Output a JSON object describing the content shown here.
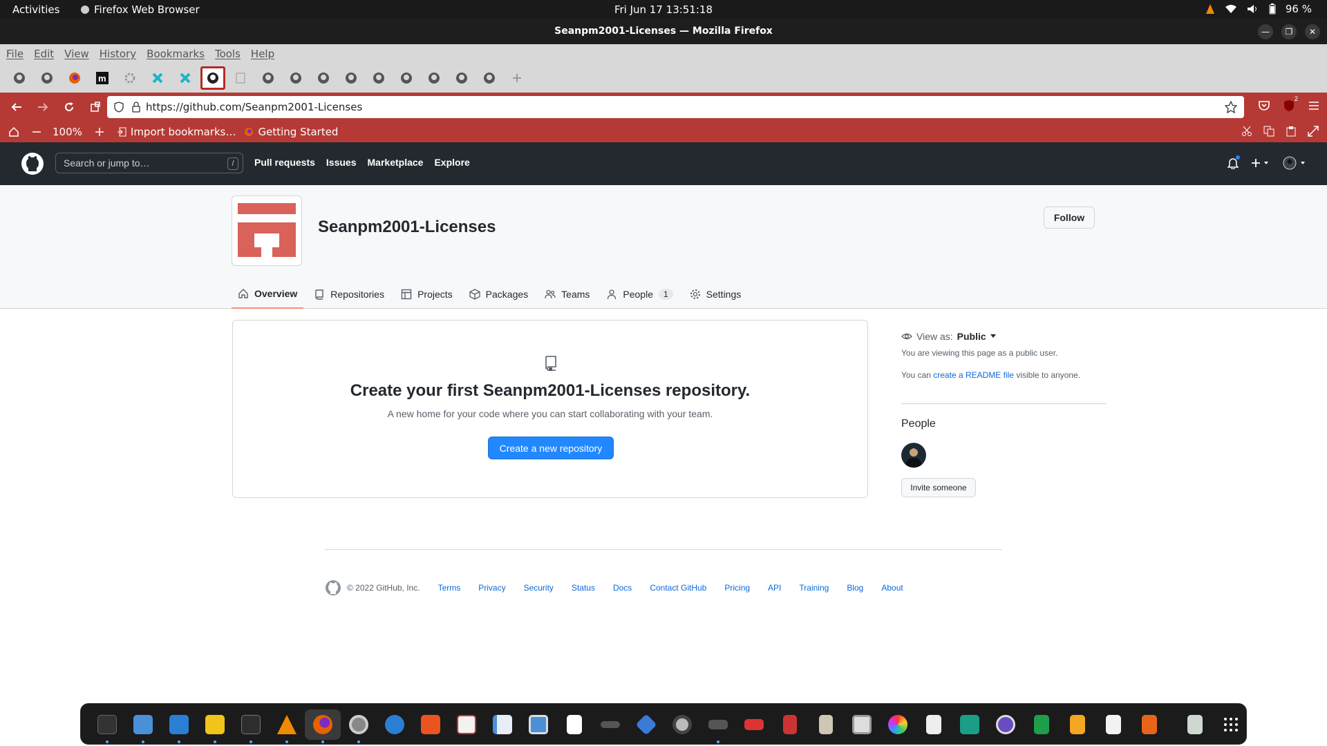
{
  "system": {
    "activities": "Activities",
    "app_name": "Firefox Web Browser",
    "clock": "Fri Jun 17  13:51:18",
    "battery": "96 %"
  },
  "window": {
    "title": "Seanpm2001-Licenses — Mozilla Firefox"
  },
  "menubar": {
    "items": [
      "File",
      "Edit",
      "View",
      "History",
      "Bookmarks",
      "Tools",
      "Help"
    ]
  },
  "navbar": {
    "url": "https://github.com/Seanpm2001-Licenses",
    "ext_badge": "2"
  },
  "bookmarks_bar": {
    "zoom": "100%",
    "items": [
      "Import bookmarks…",
      "Getting Started"
    ]
  },
  "github_header": {
    "search_placeholder": "Search or jump to…",
    "search_shortcut": "/",
    "nav": [
      "Pull requests",
      "Issues",
      "Marketplace",
      "Explore"
    ]
  },
  "org": {
    "name": "Seanpm2001-Licenses",
    "follow_label": "Follow",
    "avatar_color": "#d9625a",
    "tabs": [
      {
        "label": "Overview",
        "icon": "home-icon",
        "selected": true
      },
      {
        "label": "Repositories",
        "icon": "repo-icon"
      },
      {
        "label": "Projects",
        "icon": "table-icon"
      },
      {
        "label": "Packages",
        "icon": "package-icon"
      },
      {
        "label": "Teams",
        "icon": "people-icon"
      },
      {
        "label": "People",
        "icon": "person-icon",
        "count": "1"
      },
      {
        "label": "Settings",
        "icon": "gear-icon"
      }
    ]
  },
  "blankslate": {
    "title": "Create your first Seanpm2001-Licenses repository.",
    "description": "A new home for your code where you can start collaborating with your team.",
    "button": "Create a new repository"
  },
  "sidebar": {
    "view_as_label": "View as:",
    "view_as_value": "Public",
    "viewing_text": "You are viewing this page as a public user.",
    "readme_prefix": "You can ",
    "readme_link": "create a README file",
    "readme_suffix": " visible to anyone.",
    "people_heading": "People",
    "invite_button": "Invite someone"
  },
  "footer": {
    "copyright": "© 2022 GitHub, Inc.",
    "links": [
      "Terms",
      "Privacy",
      "Security",
      "Status",
      "Docs",
      "Contact GitHub",
      "Pricing",
      "API",
      "Training",
      "Blog",
      "About"
    ]
  },
  "colors": {
    "accent_blue": "#2188ff",
    "firefox_theme_red": "#b53a35",
    "github_header": "#24292f"
  }
}
